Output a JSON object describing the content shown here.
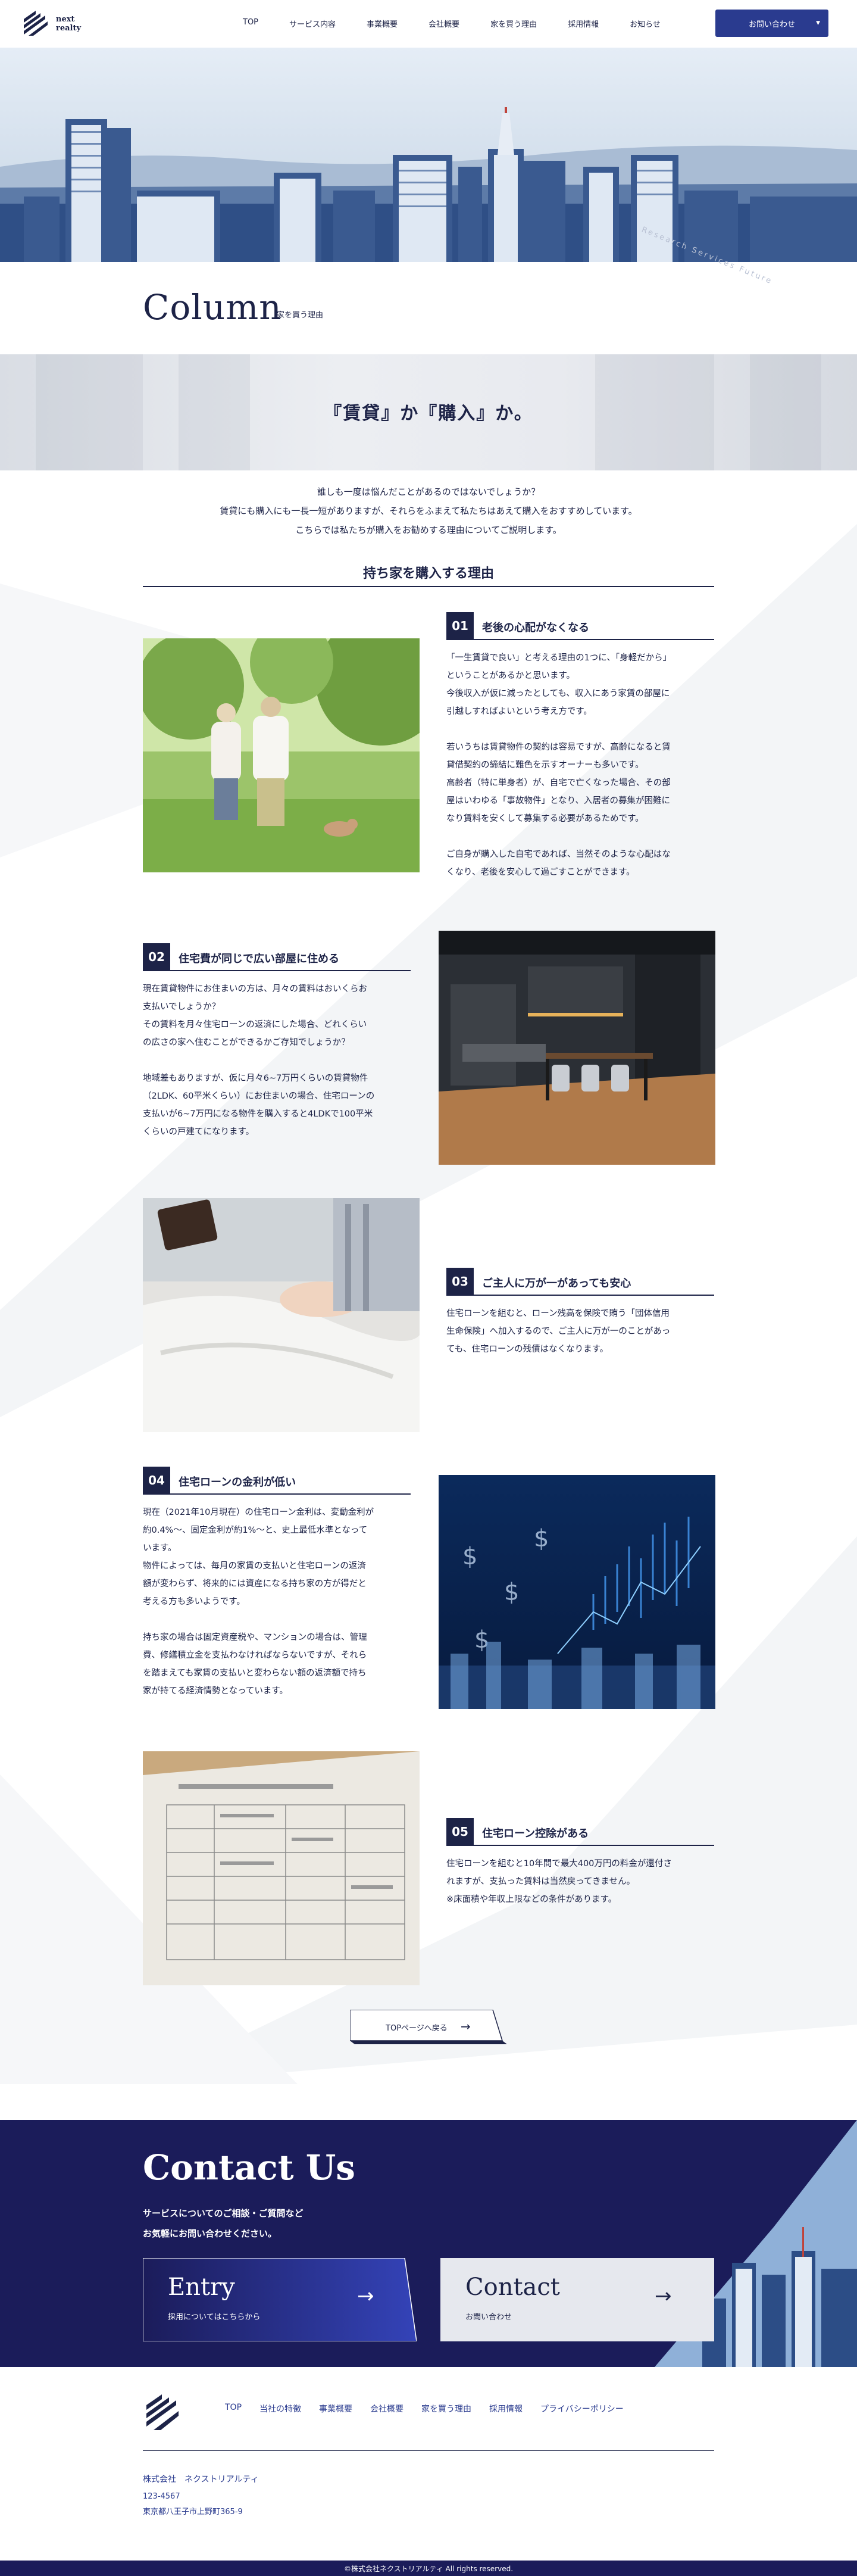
{
  "header": {
    "logo_line1": "next",
    "logo_line2": "realty",
    "nav": [
      "TOP",
      "サービス内容",
      "事業概要",
      "会社概要",
      "家を買う理由",
      "採用情報",
      "お知らせ"
    ],
    "cta_label": "お問い合わせ",
    "cta_caret": "▼"
  },
  "hero": {
    "circle_text": "Research Services Future"
  },
  "page_title": {
    "title": "Column",
    "subtitle": "家を買う理由"
  },
  "banner": {
    "title": "『賃貸』か『購入』か。"
  },
  "intro": {
    "lines": [
      "誰しも一度は悩んだことがあるのではないでしょうか？",
      "賃貸にも購入にも一長一短がありますが、それらをふまえて私たちはあえて購入をおすすめしています。",
      "こちらでは私たちが購入をお勧めする理由についてご説明します。"
    ]
  },
  "section_heading": "持ち家を購入する理由",
  "reasons": [
    {
      "num": "01",
      "title": "老後の心配がなくなる",
      "paragraphs": [
        [
          "「一生賃貸で良い」と考える理由の1つに、「身軽だから」",
          "ということがあるかと思います。",
          "今後収入が仮に減ったとしても、収入にあう家賃の部屋に",
          "引越しすればよいという考え方です。"
        ],
        [
          "若いうちは賃貸物件の契約は容易ですが、高齢になると賃",
          "貸借契約の締結に難色を示すオーナーも多いです。",
          "高齢者（特に単身者）が、自宅で亡くなった場合、その部",
          "屋はいわゆる「事故物件」となり、入居者の募集が困難に",
          "なり賃料を安くして募集する必要があるためです。"
        ],
        [
          "ご自身が購入した自宅であれば、当然そのような心配はな",
          "くなり、老後を安心して過ごすことができます。"
        ]
      ]
    },
    {
      "num": "02",
      "title": "住宅費が同じで広い部屋に住める",
      "paragraphs": [
        [
          "現在賃貸物件にお住まいの方は、月々の賃料はおいくらお",
          "支払いでしょうか？",
          "その賃料を月々住宅ローンの返済にした場合、どれくらい",
          "の広さの家へ住むことができるかご存知でしょうか？"
        ],
        [
          "地域差もありますが、仮に月々6~7万円くらいの賃貸物件",
          "（2LDK、60平米くらい）にお住まいの場合、住宅ローンの",
          "支払いが6~7万円になる物件を購入すると4LDKで100平米",
          "くらいの戸建てになります。"
        ]
      ]
    },
    {
      "num": "03",
      "title": "ご主人に万が一があっても安心",
      "paragraphs": [
        [
          "住宅ローンを組むと、ローン残高を保険で賄う「団体信用",
          "生命保険」へ加入するので、ご主人に万が一のことがあっ",
          "ても、住宅ローンの残債はなくなります。"
        ]
      ]
    },
    {
      "num": "04",
      "title": "住宅ローンの金利が低い",
      "paragraphs": [
        [
          "現在（2021年10月現在）の住宅ローン金利は、変動金利が",
          "約0.4%～、固定金利が約1%～と、史上最低水準となって",
          "います。",
          "物件によっては、毎月の家賃の支払いと住宅ローンの返済",
          "額が変わらず、将来的には資産になる持ち家の方が得だと",
          "考える方も多いようです。"
        ],
        [
          "持ち家の場合は固定資産税や、マンションの場合は、管理",
          "費、修繕積立金を支払わなければならないですが、それら",
          "を踏まえても家賃の支払いと変わらない額の返済額で持ち",
          "家が持てる経済情勢となっています。"
        ]
      ]
    },
    {
      "num": "05",
      "title": "住宅ローン控除がある",
      "paragraphs": [
        [
          "住宅ローンを組むと10年間で最大400万円の料金が還付さ",
          "れますが、支払った賃料は当然戻ってきません。",
          "※床面積や年収上限などの条件があります。"
        ]
      ]
    }
  ],
  "back_button": {
    "label": "TOPページへ戻る",
    "arrow": "→"
  },
  "contact": {
    "title": "Contact Us",
    "text_lines": [
      "サービスについてのご相談・ご質問など",
      "お気軽にお問い合わせください。"
    ],
    "entry": {
      "title": "Entry",
      "sub": "採用についてはこちらから",
      "arrow": "→"
    },
    "contact_card": {
      "title": "Contact",
      "sub": "お問い合わせ",
      "arrow": "→"
    }
  },
  "footer": {
    "nav": [
      "TOP",
      "当社の特徴",
      "事業概要",
      "会社概要",
      "家を買う理由",
      "採用情報",
      "プライバシーポリシー"
    ],
    "company": "株式会社　ネクストリアルティ",
    "zip": "123-4567",
    "address": "東京都八王子市上野町365-9",
    "copyright": "©株式会社ネクストリアルティ All rights reserved."
  },
  "colors": {
    "navy": "#1d2347",
    "accent": "#2a3b8f",
    "contact_bg": "#1b1c5a"
  }
}
